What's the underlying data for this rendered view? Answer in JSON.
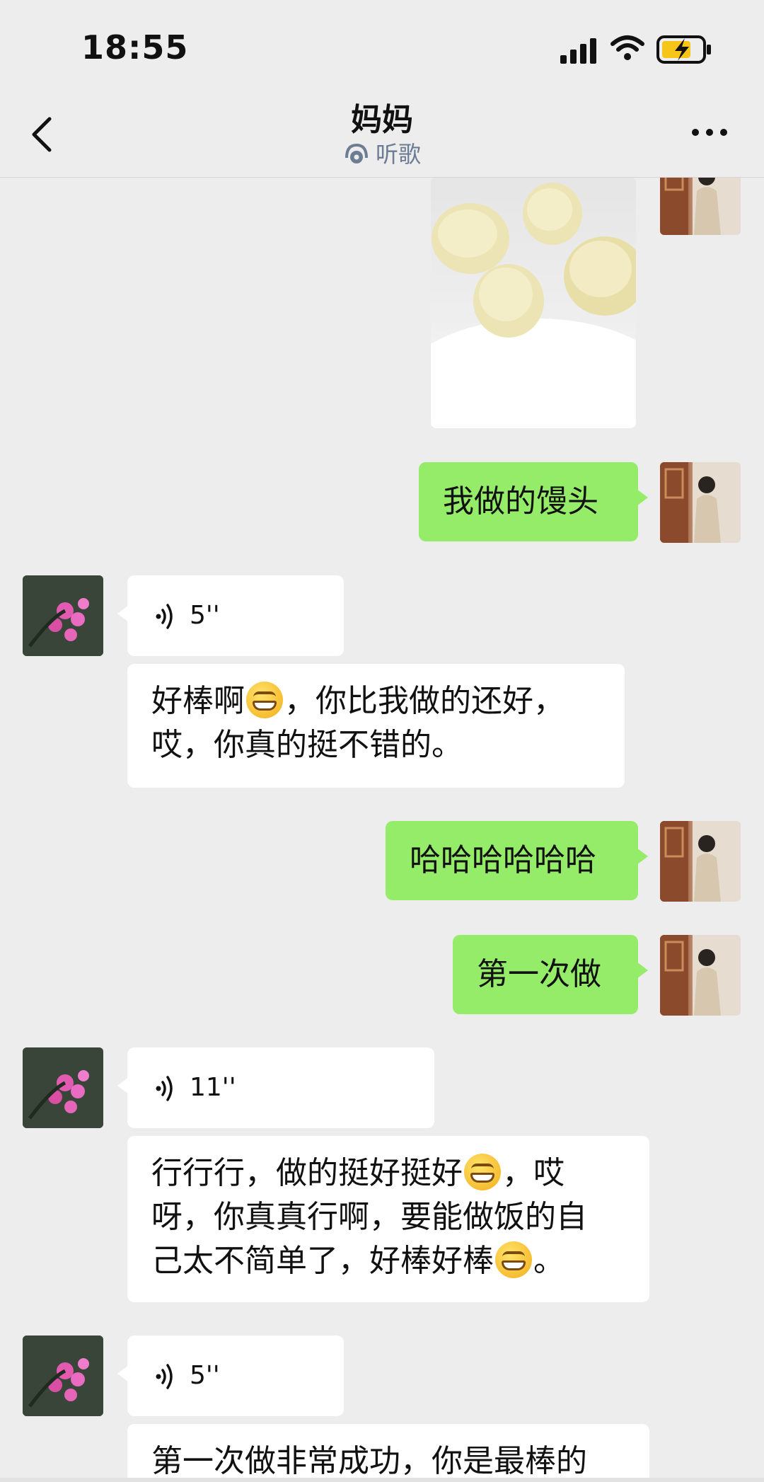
{
  "status_bar": {
    "time": "18:55"
  },
  "nav": {
    "title": "妈妈",
    "subtitle": "听歌"
  },
  "messages": {
    "m1_text": "我做的馒头",
    "m2_voice": "5''",
    "m3_text_a": "好棒啊",
    "m3_text_b": "，你比我做的还好，",
    "m3_text_c": "哎，你真的挺不错的。",
    "m4_text": "哈哈哈哈哈哈",
    "m5_text": "第一次做",
    "m6_voice": "11''",
    "m7_text_a": "行行行，做的挺好挺好",
    "m7_text_b": "，哎",
    "m7_text_c": "呀，你真真行啊，要能做饭的自",
    "m7_text_d": "己太不简单了，好棒好棒",
    "m7_text_e": "。",
    "m8_voice": "5''",
    "m9_text": "第一次做非常成功，你是最棒的"
  },
  "icons": {
    "back": "chevron-left-icon",
    "more": "more-dots-icon",
    "listen": "headphones-icon",
    "voice": "voice-wave-icon",
    "emoji": "grinning-emoji-icon"
  },
  "colors": {
    "background": "#ededed",
    "sent_bubble": "#95ec69",
    "received_bubble": "#ffffff",
    "subtitle": "#6b7c93"
  }
}
